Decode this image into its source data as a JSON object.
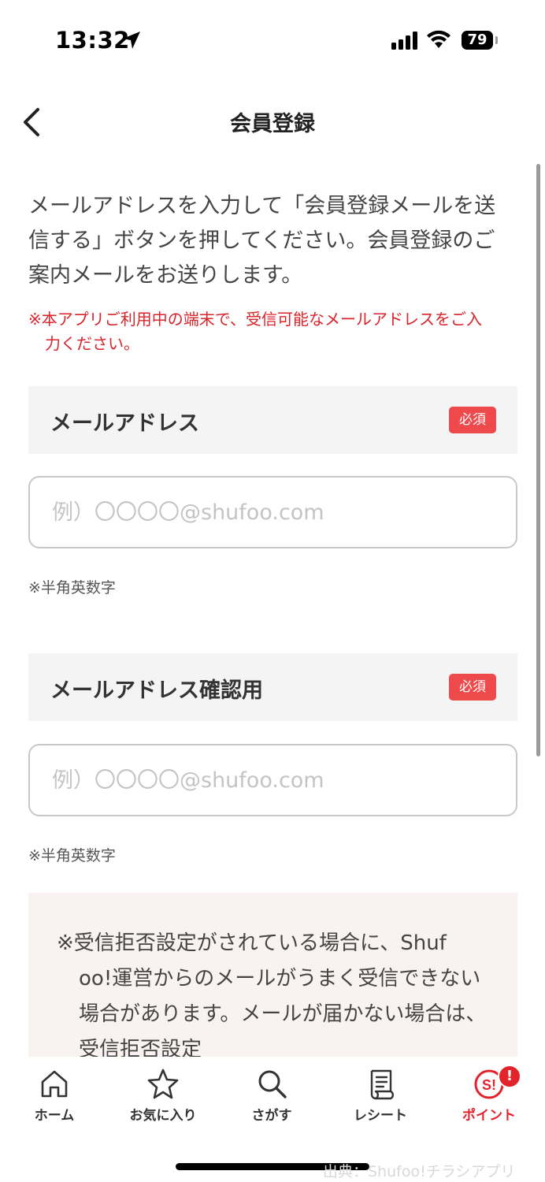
{
  "status_bar": {
    "time": "13:32",
    "battery": "79"
  },
  "header": {
    "title": "会員登録"
  },
  "intro": {
    "text": "メールアドレスを入力して「会員登録メールを送信する」ボタンを押してください。会員登録のご案内メールをお送りします。",
    "warning_line1": "※本アプリご利用中の端末で、受信可能なメールアドレスをご入",
    "warning_line2": "力ください。"
  },
  "fields": [
    {
      "label": "メールアドレス",
      "required": "必須",
      "placeholder": "例）〇〇〇〇@shufoo.com",
      "value": "",
      "hint": "※半角英数字"
    },
    {
      "label": "メールアドレス確認用",
      "required": "必須",
      "placeholder": "例）〇〇〇〇@shufoo.com",
      "value": "",
      "hint": "※半角英数字"
    }
  ],
  "notice": {
    "line1": "※受信拒否設定がされている場合に、Shuf",
    "rest": "oo!運営からのメールがうまく受信できない場合があります。メールが届かない場合は、受信拒否設定"
  },
  "nav": {
    "items": [
      {
        "label": "ホーム",
        "icon": "home-icon"
      },
      {
        "label": "お気に入り",
        "icon": "star-icon"
      },
      {
        "label": "さがす",
        "icon": "search-icon"
      },
      {
        "label": "レシート",
        "icon": "receipt-icon"
      },
      {
        "label": "ポイント",
        "icon": "points-icon",
        "badge": "!"
      }
    ]
  },
  "watermark": "出典：Shufoo!チラシアプリ",
  "colors": {
    "accent": "#e3232b",
    "badge": "#ee4a4c",
    "field_bg": "#f4f4f4",
    "notice_bg": "#f8f3f0"
  }
}
